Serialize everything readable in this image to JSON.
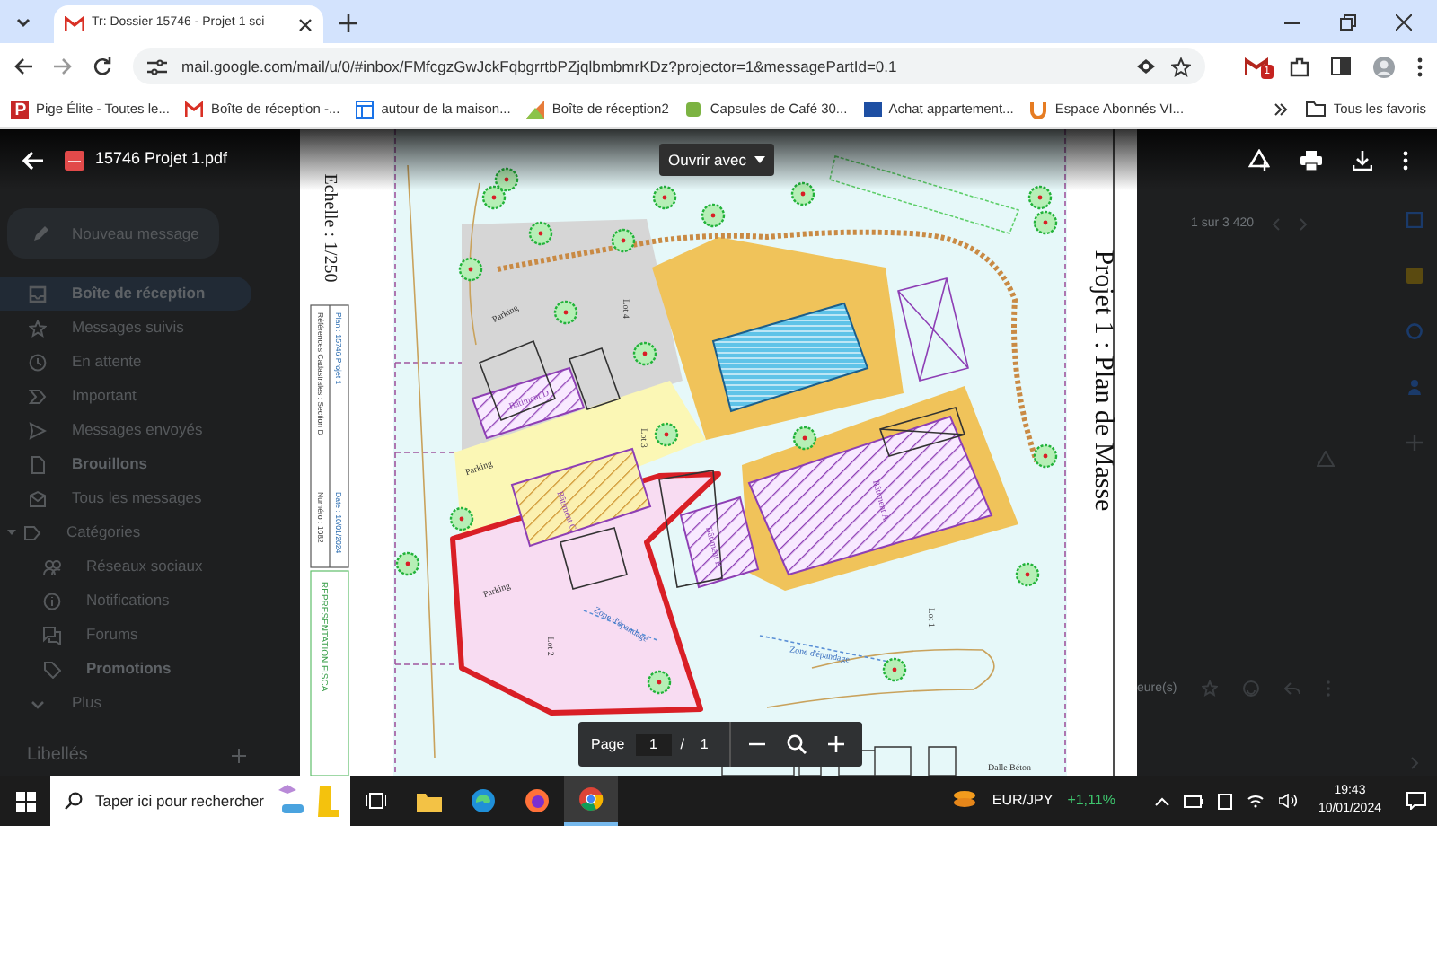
{
  "browser": {
    "tab_title": "Tr: Dossier 15746 - Projet 1 sci",
    "address": "mail.google.com/mail/u/0/#inbox/FMfcgzGwJckFqbgrrtbPZjqlbmbmrKDz?projector=1&messagePartId=0.1",
    "extension_badge": "1",
    "bookmarks": [
      "Pige Élite - Toutes le...",
      "Boîte de réception -...",
      "autour de la maison...",
      "Boîte de réception2",
      "Capsules de Café 30...",
      "Achat appartement...",
      "Espace Abonnés VI..."
    ],
    "all_bookmarks": "Tous les favoris"
  },
  "gmail": {
    "compose": "Nouveau message",
    "folders": [
      {
        "label": "Boîte de réception",
        "selected": true,
        "unread": true
      },
      {
        "label": "Messages suivis",
        "selected": false,
        "unread": false
      },
      {
        "label": "En attente",
        "selected": false,
        "unread": false
      },
      {
        "label": "Important",
        "selected": false,
        "unread": false
      },
      {
        "label": "Messages envoyés",
        "selected": false,
        "unread": false
      },
      {
        "label": "Brouillons",
        "selected": false,
        "unread": true
      },
      {
        "label": "Tous les messages",
        "selected": false,
        "unread": false
      },
      {
        "label": "Catégories",
        "selected": false,
        "unread": false,
        "expanded": true,
        "children": [
          {
            "label": "Réseaux sociaux",
            "selected": false,
            "unread": false
          },
          {
            "label": "Notifications",
            "selected": false,
            "unread": false
          },
          {
            "label": "Forums",
            "selected": false,
            "unread": false
          },
          {
            "label": "Promotions",
            "selected": false,
            "unread": true
          }
        ]
      },
      {
        "label": "Plus",
        "selected": false,
        "unread": false
      }
    ],
    "labels_heading": "Libellés",
    "pager": "1 sur 3 420",
    "snippet": "eure(s)"
  },
  "viewer": {
    "file_name": "15746 Projet 1.pdf",
    "open_with": "Ouvrir avec",
    "page_label": "Page",
    "page": "1",
    "separator": "/",
    "pages": "1"
  },
  "plan": {
    "scale": "Echelle : 1/250",
    "title": "Projet 1 : Plan de Masse",
    "cadastre": [
      "Références Cadastrales :  Section D",
      "Numéro : 1082"
    ],
    "plan_ref": [
      "Plan : 15746 Projet 1",
      "Date : 10/01/2024"
    ],
    "legend": "REPRESENTATION FISCA",
    "labels": [
      "Parking",
      "Parking",
      "Parking",
      "Lot 4",
      "Lot 3",
      "Lot 2",
      "Lot 1",
      "Bâtiment A",
      "Bâtiment B",
      "Bâtiment C",
      "Bâtiment D",
      "Zone d'épandage",
      "Zone d'épandage",
      "Dalle Béton"
    ]
  },
  "taskbar": {
    "search_placeholder": "Taper ici pour rechercher",
    "ticker": "EUR/JPY",
    "change": "+1,11%",
    "time": "19:43",
    "date": "10/01/2024"
  }
}
